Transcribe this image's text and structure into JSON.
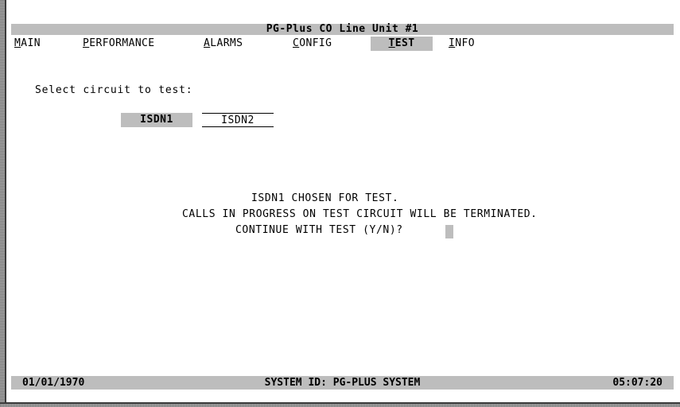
{
  "title": "PG-Plus CO Line Unit #1",
  "menu": [
    {
      "hot": "M",
      "rest": "AIN"
    },
    {
      "hot": "P",
      "rest": "ERFORMANCE"
    },
    {
      "hot": "A",
      "rest": "LARMS"
    },
    {
      "hot": "C",
      "rest": "ONFIG"
    },
    {
      "hot": "T",
      "rest": "EST"
    },
    {
      "hot": "I",
      "rest": "NFO"
    }
  ],
  "active_menu": "TEST",
  "prompt": "Select circuit to test:",
  "circuits": [
    {
      "label": "ISDN1",
      "selected": true
    },
    {
      "label": "ISDN2",
      "selected": false
    }
  ],
  "messages": [
    "ISDN1 CHOSEN FOR TEST.",
    "CALLS IN PROGRESS ON TEST CIRCUIT WILL BE TERMINATED.",
    "CONTINUE WITH TEST (Y/N)?"
  ],
  "status": {
    "date": "01/01/1970",
    "system_id": "SYSTEM ID: PG-PLUS SYSTEM",
    "time": "05:07:20"
  }
}
